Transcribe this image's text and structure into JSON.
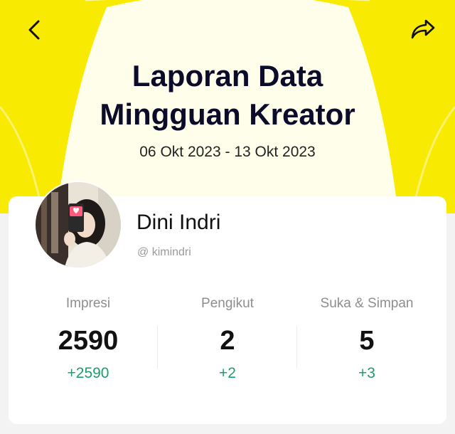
{
  "header": {
    "title_line1": "Laporan Data",
    "title_line2": "Mingguan Kreator",
    "date_range": "06 Okt 2023 - 13 Okt 2023"
  },
  "icons": {
    "back": "chevron-left-icon",
    "share": "share-arrow-icon"
  },
  "profile": {
    "name": "Dini Indri",
    "handle": "@ kimindri"
  },
  "stats": [
    {
      "label": "Impresi",
      "value": "2590",
      "delta": "+2590"
    },
    {
      "label": "Pengikut",
      "value": "2",
      "delta": "+2"
    },
    {
      "label": "Suka & Simpan",
      "value": "5",
      "delta": "+3"
    }
  ],
  "colors": {
    "hero_yellow": "#f8ea00",
    "delta_green": "#1e9e6a",
    "title_navy": "#0c0c2a"
  }
}
